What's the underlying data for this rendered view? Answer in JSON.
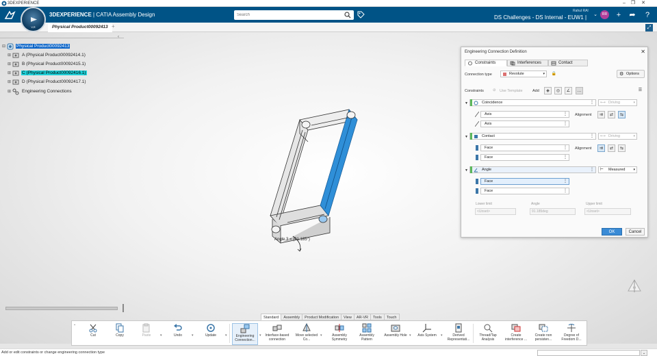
{
  "window": {
    "title": "3DEXPERIENCE",
    "minimize": "–",
    "maximize": "❐",
    "close": "✕"
  },
  "header": {
    "brand_bold": "3DEXPERIENCE",
    "brand_rest": " | CATIA Assembly Design",
    "search_placeholder": "Search",
    "user_name": "Rahul RAI",
    "user_initials": "RR",
    "environment": "DS Challenges - DS Internal - EUW1 |",
    "compass_version": "V,R"
  },
  "document_tab": {
    "label": "Physical Product00092413",
    "add": "+"
  },
  "tree": {
    "items": [
      {
        "label": "Physical Product00092413"
      },
      {
        "label": "A (Physical Product00092414.1)"
      },
      {
        "label": "B (Physical Product00092415.1)"
      },
      {
        "label": "C (Physical Product00092416.1)"
      },
      {
        "label": "D (Physical Product00092417.1)"
      },
      {
        "label": "Engineering Connections"
      }
    ]
  },
  "viewport": {
    "angle_label": "Angle.3 = (91.185°)"
  },
  "dialog": {
    "title": "Engineering Connection Definition",
    "tabs": [
      "Constraints",
      "Interferences",
      "Contact"
    ],
    "connection_type_label": "Connection type",
    "connection_type_value": "Revolute",
    "options_label": "Options",
    "constraints_label": "Constraints",
    "use_template_label": "Use Template",
    "add_label": "Add",
    "constraints": [
      {
        "name": "Coincidence",
        "mode": "Driving",
        "alignment_label": "Alignment",
        "geometry": [
          "Axis",
          "Axis"
        ]
      },
      {
        "name": "Contact",
        "mode": "Driving",
        "alignment_label": "Alignment",
        "geometry": [
          "Face",
          "Face"
        ]
      },
      {
        "name": "Angle",
        "mode": "Measured",
        "geometry": [
          "Face",
          "Face"
        ]
      }
    ],
    "lower_limit_label": "Lower limit",
    "lower_limit_value": "<Unset>",
    "angle_label": "Angle",
    "angle_value": "91.185deg",
    "upper_limit_label": "Upper limit",
    "upper_limit_value": "<Unset>",
    "ok_label": "OK",
    "cancel_label": "Cancel"
  },
  "section_tabs": [
    "Standard",
    "Assembly",
    "Product Modification",
    "View",
    "AR-VR",
    "Tools",
    "Touch"
  ],
  "toolbar": [
    {
      "label": "Cut"
    },
    {
      "label": "Copy"
    },
    {
      "label": "Paste"
    },
    {
      "label": "Undo"
    },
    {
      "label": "Update"
    },
    {
      "label": "Engineering Connection..."
    },
    {
      "label": "Interface-based connection"
    },
    {
      "label": "Move selected Co..."
    },
    {
      "label": "Assembly Symmetry"
    },
    {
      "label": "Assembly Pattern"
    },
    {
      "label": "Assembly Hole"
    },
    {
      "label": "Axis System"
    },
    {
      "label": "Derived Representati..."
    },
    {
      "label": "Thread/Tap Analysis"
    },
    {
      "label": "Create interference ..."
    },
    {
      "label": "Create non persisten..."
    },
    {
      "label": "Degree of Freedom D..."
    }
  ],
  "status": {
    "text": "Add or edit constraints or change engineering connection type"
  },
  "colors": {
    "header": "#005386",
    "tree_selection": "#0a64c8",
    "highlight": "#1fd0d8",
    "ok_button": "#3a8bd6",
    "constraint_bar": "#5cb85c"
  }
}
